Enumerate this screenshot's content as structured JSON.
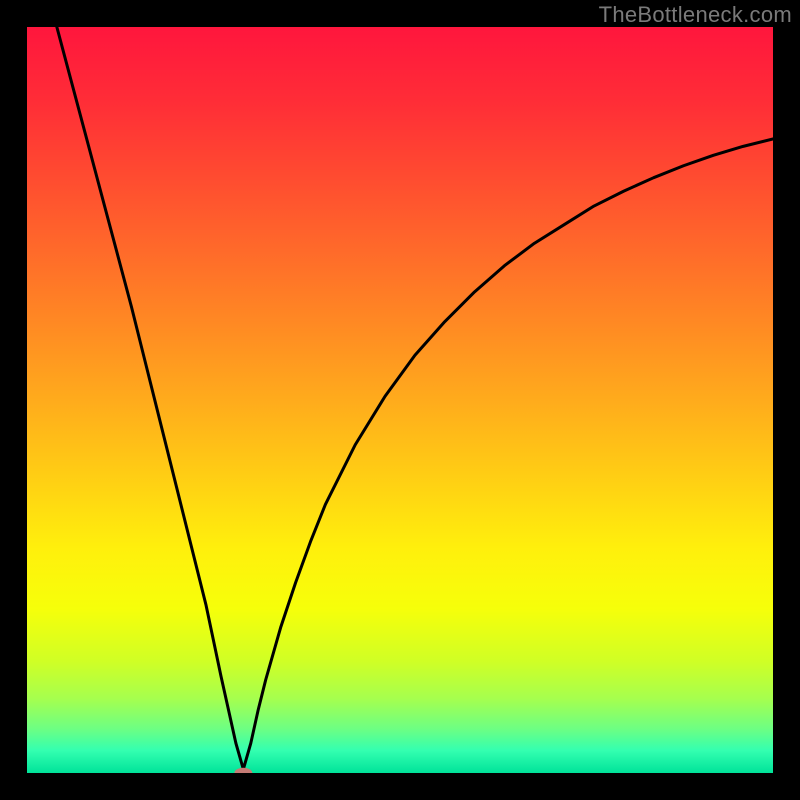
{
  "watermark": "TheBottleneck.com",
  "gradient": {
    "stops": [
      {
        "offset": 0.0,
        "color": "#ff163d"
      },
      {
        "offset": 0.1,
        "color": "#ff2d37"
      },
      {
        "offset": 0.2,
        "color": "#ff4b30"
      },
      {
        "offset": 0.3,
        "color": "#ff6a2a"
      },
      {
        "offset": 0.4,
        "color": "#ff8a23"
      },
      {
        "offset": 0.5,
        "color": "#ffab1c"
      },
      {
        "offset": 0.6,
        "color": "#ffcd14"
      },
      {
        "offset": 0.7,
        "color": "#fff00c"
      },
      {
        "offset": 0.78,
        "color": "#f6ff0a"
      },
      {
        "offset": 0.85,
        "color": "#d0ff25"
      },
      {
        "offset": 0.9,
        "color": "#a6ff4e"
      },
      {
        "offset": 0.94,
        "color": "#6eff82"
      },
      {
        "offset": 0.97,
        "color": "#33ffb0"
      },
      {
        "offset": 1.0,
        "color": "#00e39a"
      }
    ]
  },
  "chart_data": {
    "type": "line",
    "title": "",
    "xlabel": "",
    "ylabel": "",
    "xlim": [
      0,
      100
    ],
    "ylim": [
      0,
      100
    ],
    "grid": false,
    "curve_minimum_x": 29,
    "marker": {
      "x": 29,
      "y": 0,
      "color": "#c47b75",
      "rx": 1.2,
      "ry": 0.7
    },
    "_comment_": "values are the y-height of the black curve at each x; y=0 is the bottom (green) edge and y=100 is the top (red) edge; values visually estimated from gradient background",
    "series": [
      {
        "name": "curve",
        "x": [
          4,
          6,
          8,
          10,
          12,
          14,
          16,
          18,
          20,
          22,
          24,
          26,
          27,
          28,
          29,
          30,
          31,
          32,
          34,
          36,
          38,
          40,
          44,
          48,
          52,
          56,
          60,
          64,
          68,
          72,
          76,
          80,
          84,
          88,
          92,
          96,
          100
        ],
        "values": [
          100,
          92.5,
          85,
          77.5,
          70,
          62.5,
          54.5,
          46.5,
          38.5,
          30.5,
          22.5,
          13,
          8.5,
          4,
          0.5,
          4,
          8.5,
          12.5,
          19.5,
          25.5,
          31,
          36,
          44,
          50.5,
          56,
          60.5,
          64.5,
          68,
          71,
          73.5,
          76,
          78,
          79.8,
          81.4,
          82.8,
          84,
          85
        ]
      }
    ]
  }
}
